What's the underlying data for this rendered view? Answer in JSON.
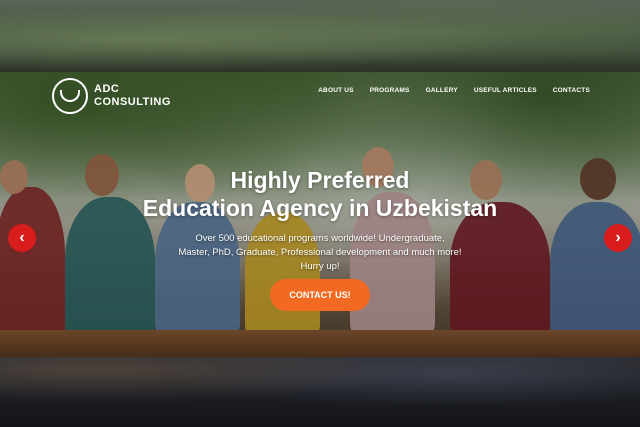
{
  "logo": {
    "line1": "ADC",
    "line2": "CONSULTING",
    "icon": "adc-consulting-logo"
  },
  "nav": {
    "items": [
      "ABOUT US",
      "PROGRAMS",
      "GALLERY",
      "USEFUL ARTICLES",
      "CONTACTS"
    ]
  },
  "hero": {
    "headline_line1": "Highly Preferred",
    "headline_line2": "Education Agency in Uzbekistan",
    "subtext_line1": "Over 500 educational programs worldwide! Undergraduate,",
    "subtext_line2": "Master, PhD, Graduate, Professional development and much more! Hurry up!",
    "cta_label": "CONTACT US!"
  },
  "carousel": {
    "prev_icon": "chevron-left-icon",
    "next_icon": "chevron-right-icon",
    "prev_glyph": "‹",
    "next_glyph": "›"
  },
  "colors": {
    "cta": "#f26a21",
    "arrows": "#d91c1c",
    "text": "#ffffff"
  }
}
